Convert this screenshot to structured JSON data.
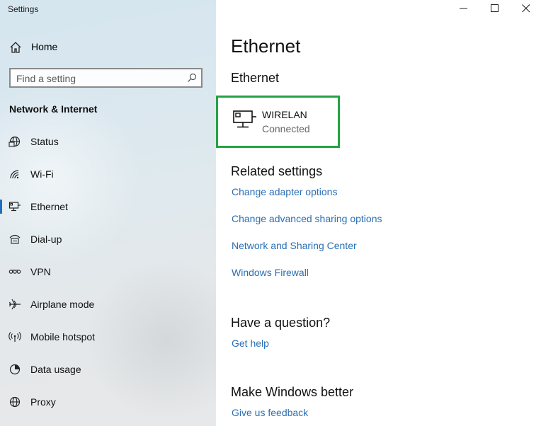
{
  "window": {
    "title": "Settings",
    "minimize_label": "—",
    "maximize_label": "☐",
    "close_label": "✕"
  },
  "sidebar": {
    "home_label": "Home",
    "search_placeholder": "Find a setting",
    "section_heading": "Network & Internet",
    "items": [
      {
        "label": "Status",
        "icon": "globe-icon",
        "selected": false
      },
      {
        "label": "Wi-Fi",
        "icon": "wifi-icon",
        "selected": false
      },
      {
        "label": "Ethernet",
        "icon": "ethernet-icon",
        "selected": true
      },
      {
        "label": "Dial-up",
        "icon": "dialup-icon",
        "selected": false
      },
      {
        "label": "VPN",
        "icon": "vpn-icon",
        "selected": false
      },
      {
        "label": "Airplane mode",
        "icon": "airplane-icon",
        "selected": false
      },
      {
        "label": "Mobile hotspot",
        "icon": "hotspot-icon",
        "selected": false
      },
      {
        "label": "Data usage",
        "icon": "data-usage-icon",
        "selected": false
      },
      {
        "label": "Proxy",
        "icon": "proxy-icon",
        "selected": false
      }
    ]
  },
  "main": {
    "title": "Ethernet",
    "subtitle": "Ethernet",
    "connection": {
      "name": "WIRELAN",
      "status": "Connected"
    },
    "related_heading": "Related settings",
    "related_links": [
      "Change adapter options",
      "Change advanced sharing options",
      "Network and Sharing Center",
      "Windows Firewall"
    ],
    "question_heading": "Have a question?",
    "help_link": "Get help",
    "better_heading": "Make Windows better",
    "feedback_link": "Give us feedback"
  },
  "colors": {
    "accent": "#1f6fc1",
    "link": "#2a6fb5",
    "highlight_border": "#24a344"
  }
}
